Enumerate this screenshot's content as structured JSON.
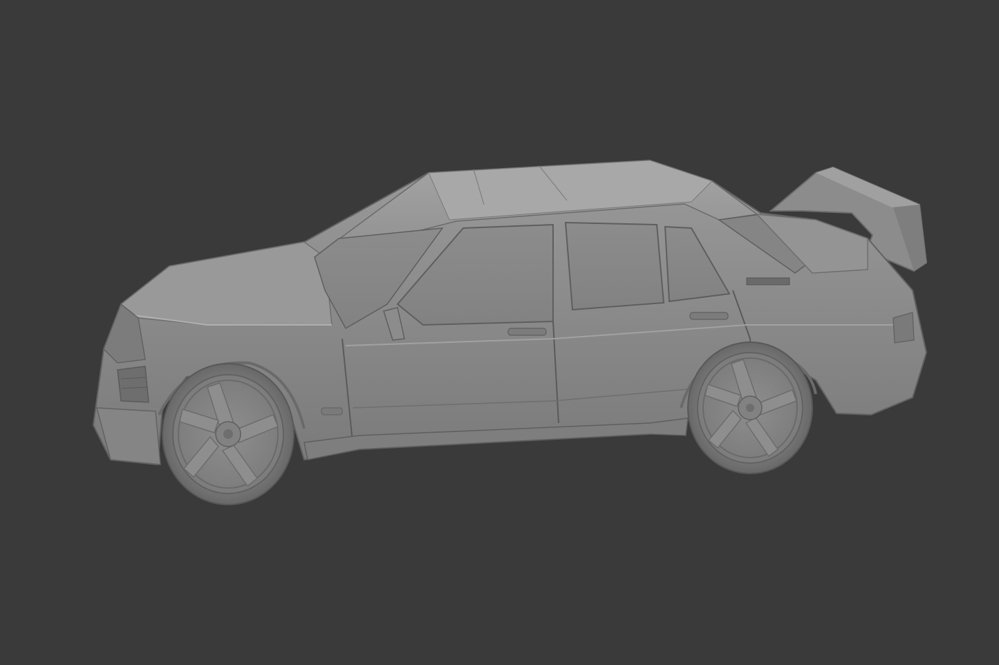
{
  "viewport": {
    "background": "#3a3a3a",
    "shading_mode": "solid",
    "model_color": "#8a8a8a",
    "model_highlight": "#a6a6a6",
    "model_shadow": "#6a6a6a"
  },
  "scene": {
    "object_icon": "car-model-icon"
  }
}
